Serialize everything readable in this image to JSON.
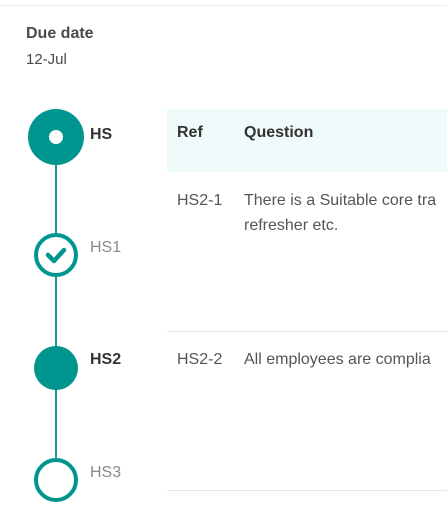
{
  "due": {
    "label": "Due date",
    "value": "12-Jul"
  },
  "steps": [
    {
      "label": "HS",
      "state": "current-parent"
    },
    {
      "label": "HS1",
      "state": "completed"
    },
    {
      "label": "HS2",
      "state": "current"
    },
    {
      "label": "HS3",
      "state": "pending"
    }
  ],
  "table": {
    "columns": [
      "Ref",
      "Question"
    ],
    "rows": [
      {
        "ref": "HS2-1",
        "question": "There is a Suitable core tra",
        "question_line2": "refresher etc."
      },
      {
        "ref": "HS2-2",
        "question": "All employees are complia"
      }
    ]
  },
  "colors": {
    "accent": "#00968f",
    "header_bg": "#effbfa"
  },
  "icons": {
    "completed": "check-icon",
    "current-parent": "dot-icon"
  }
}
